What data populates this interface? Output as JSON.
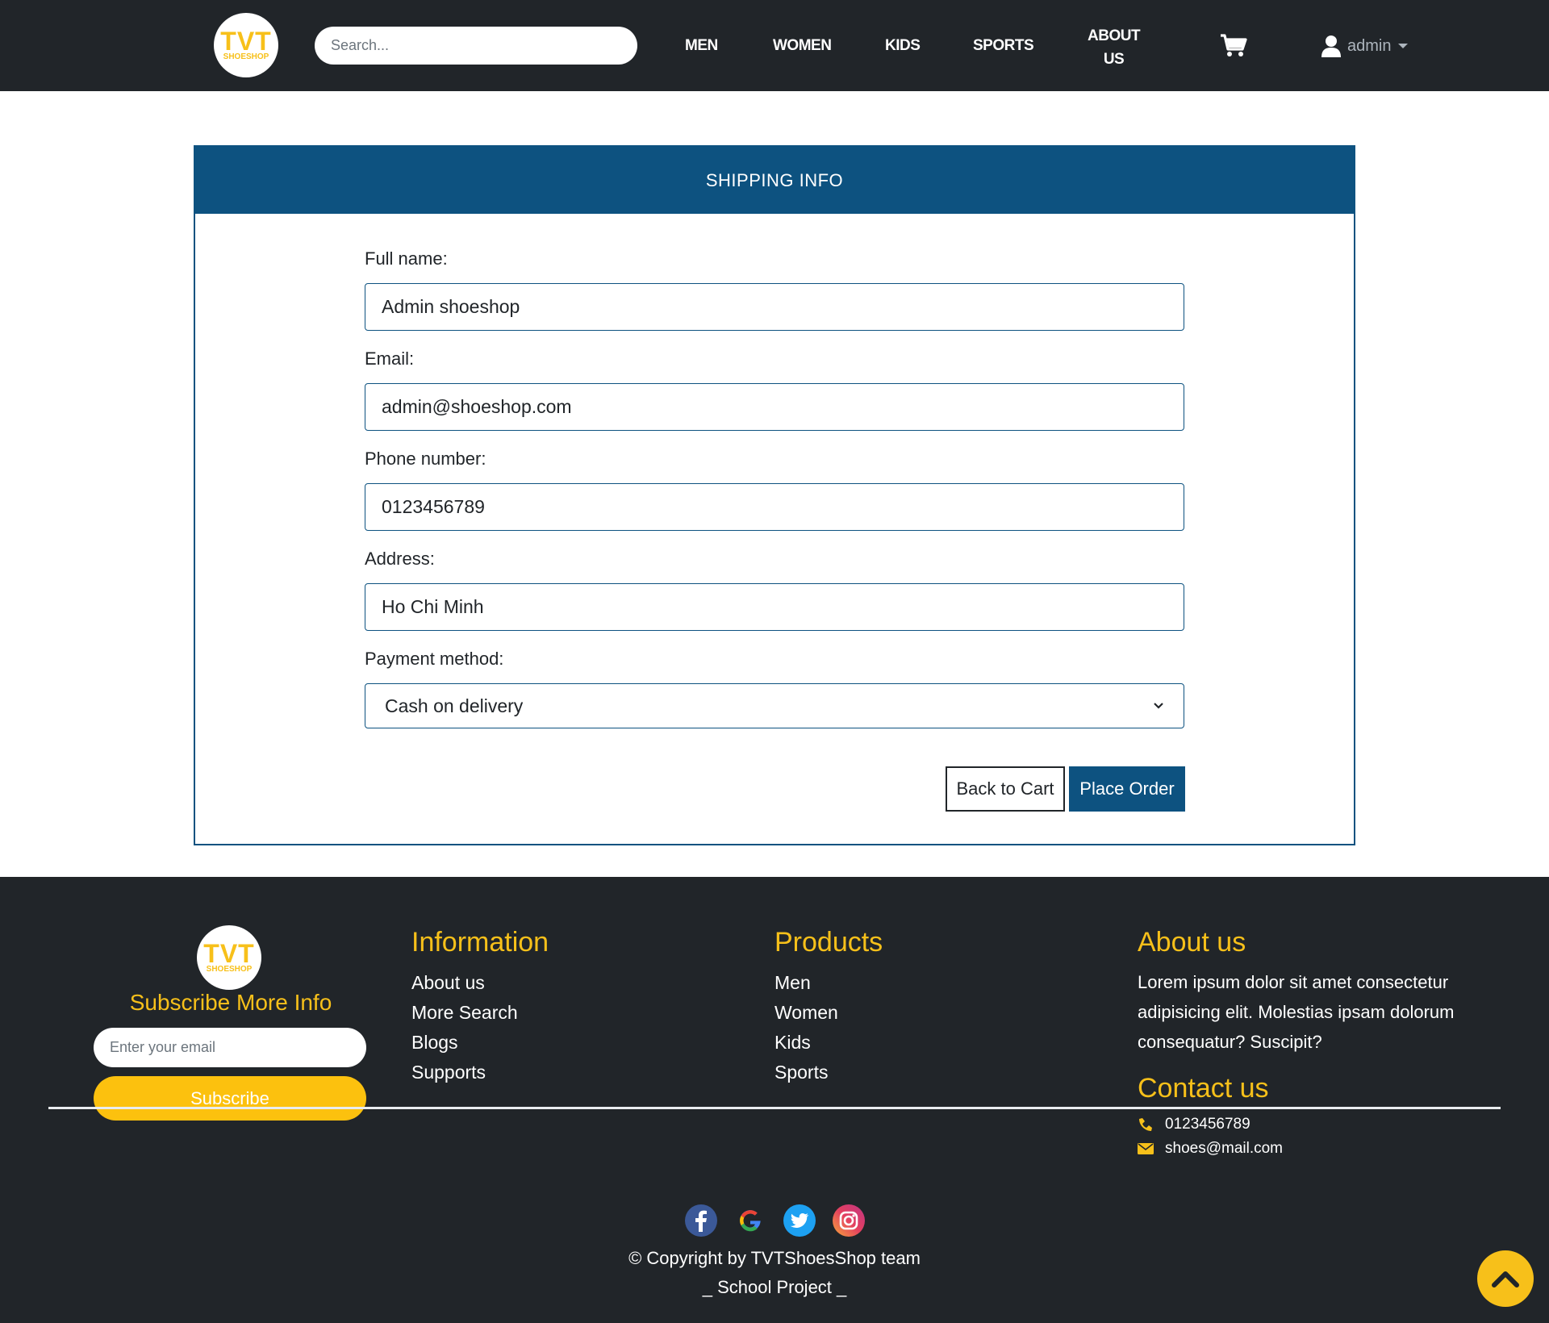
{
  "nav": {
    "logo_main": "TVT",
    "logo_sub": "SHOESHOP",
    "search_placeholder": "Search...",
    "links": [
      "MEN",
      "WOMEN",
      "KIDS",
      "SPORTS"
    ],
    "about_line1": "ABOUT",
    "about_line2": "US",
    "user": "admin"
  },
  "form": {
    "title": "SHIPPING INFO",
    "full_name_label": "Full name:",
    "full_name_value": "Admin shoeshop",
    "email_label": "Email:",
    "email_value": "admin@shoeshop.com",
    "phone_label": "Phone number:",
    "phone_value": "0123456789",
    "address_label": "Address:",
    "address_value": "Ho Chi Minh",
    "payment_label": "Payment method:",
    "payment_value": "Cash on delivery",
    "back_button": "Back to Cart",
    "place_button": "Place Order"
  },
  "footer": {
    "logo_main": "TVT",
    "logo_sub": "SHOESHOP",
    "subscribe_title": "Subscribe More Info",
    "email_placeholder": "Enter your email",
    "subscribe_button": "Subscribe",
    "information": {
      "title": "Information",
      "links": [
        "About us",
        "More Search",
        "Blogs",
        "Supports"
      ]
    },
    "products": {
      "title": "Products",
      "links": [
        "Men",
        "Women",
        "Kids",
        "Sports"
      ]
    },
    "about": {
      "title": "About us",
      "text": "Lorem ipsum dolor sit amet consectetur adipisicing elit. Molestias ipsam dolorum consequatur? Suscipit?"
    },
    "contact": {
      "title": "Contact us",
      "phone": "0123456789",
      "email": "shoes@mail.com"
    },
    "copyright": "© Copyright by TVTShoesShop team",
    "tagline": "_ School Project _"
  },
  "colors": {
    "dark": "#212529",
    "primary": "#0d5280",
    "accent": "#f7c01a"
  }
}
